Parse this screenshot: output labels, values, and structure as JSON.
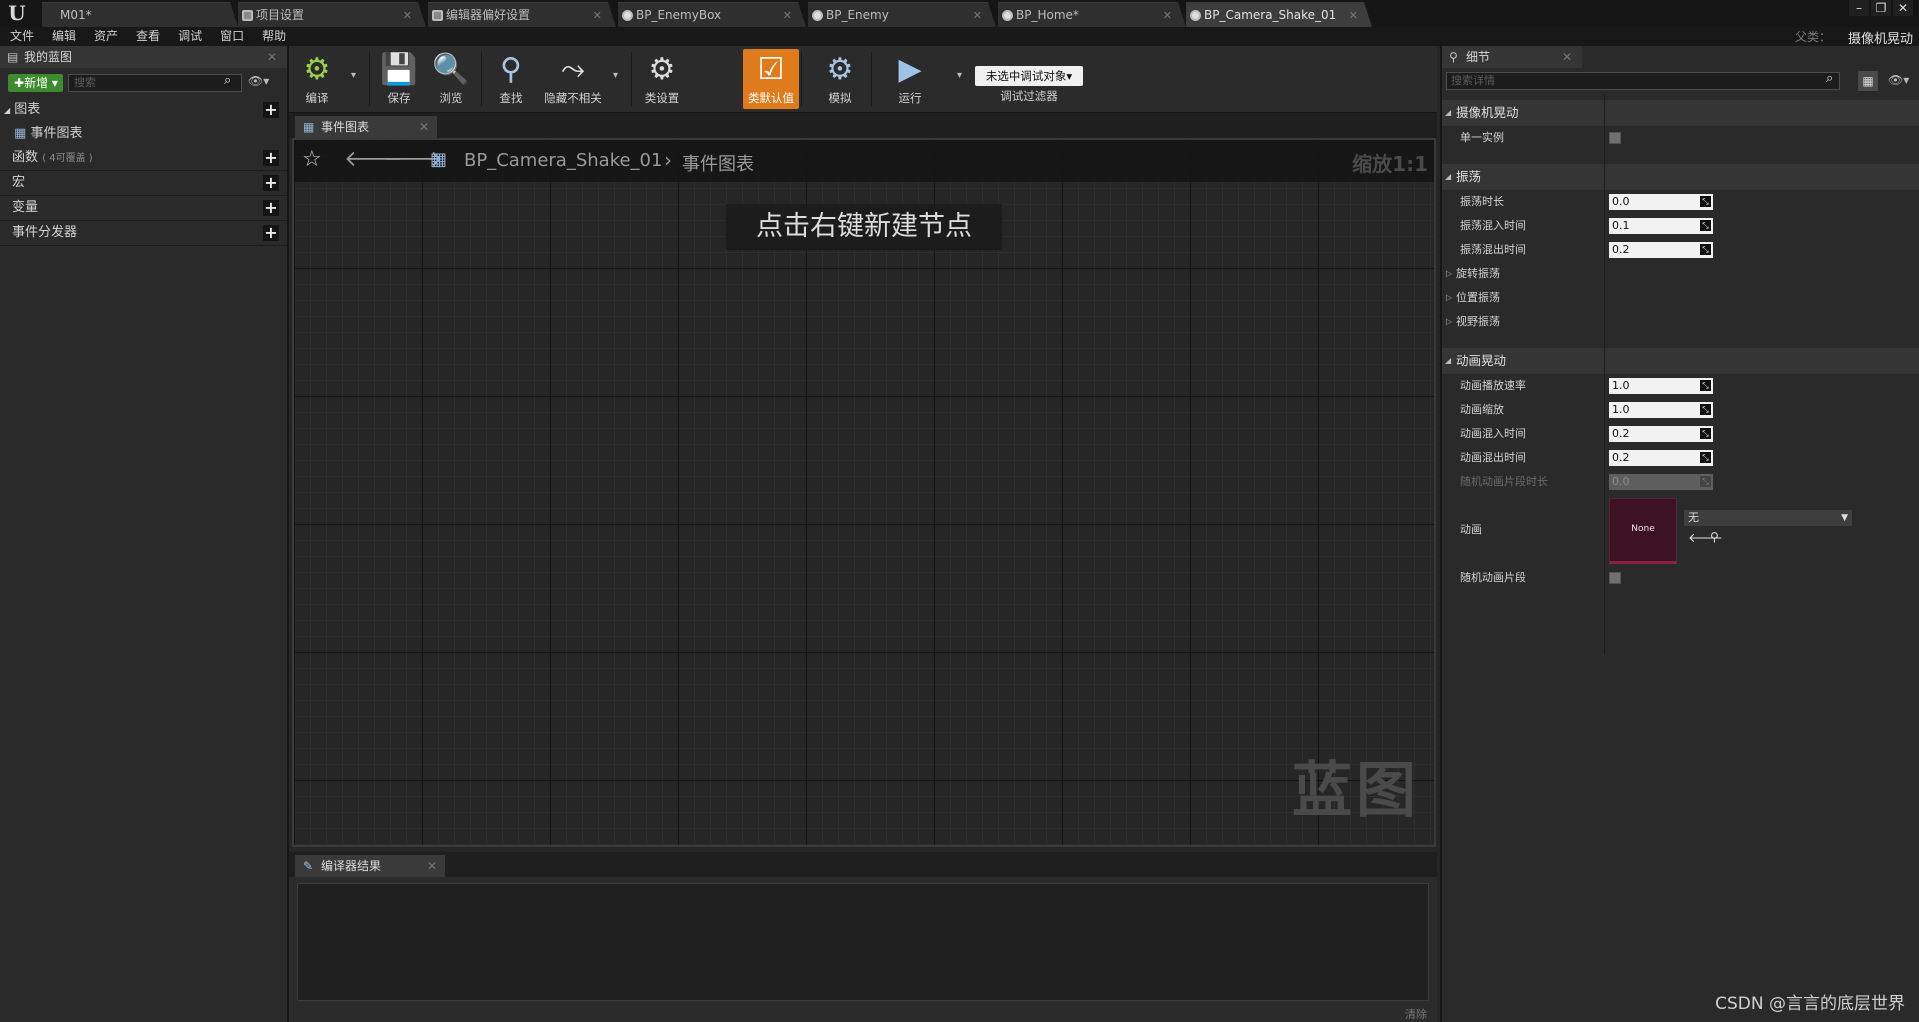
{
  "tabs": [
    {
      "label": "M01*",
      "active": false
    },
    {
      "label": "项目设置",
      "active": false
    },
    {
      "label": "编辑器偏好设置",
      "active": false
    },
    {
      "label": "BP_EnemyBox",
      "active": false
    },
    {
      "label": "BP_Enemy",
      "active": false
    },
    {
      "label": "BP_Home*",
      "active": false
    },
    {
      "label": "BP_Camera_Shake_01",
      "active": true
    }
  ],
  "parent_class": {
    "label": "父类：",
    "value": "摄像机晃动"
  },
  "menu": [
    "文件",
    "编辑",
    "资产",
    "查看",
    "调试",
    "窗口",
    "帮助"
  ],
  "my_blueprint": {
    "tab_label": "我的蓝图",
    "add_new_label": "新增",
    "search_placeholder": "搜索",
    "categories": {
      "graphs": "图表",
      "event_graph": "事件图表",
      "functions": "函数",
      "functions_sub": "( 4可覆盖 )",
      "macros": "宏",
      "variables": "变量",
      "dispatchers": "事件分发器"
    }
  },
  "toolbar": {
    "compile": "编译",
    "save": "保存",
    "browse": "浏览",
    "find": "查找",
    "hide_unrelated": "隐藏不相关",
    "class_settings": "类设置",
    "class_defaults": "类默认值",
    "simulate": "模拟",
    "play": "运行",
    "debug_object": "未选中调试对象",
    "debug_filter": "调试过滤器"
  },
  "graph": {
    "tab_label": "事件图表",
    "breadcrumb_root": "BP_Camera_Shake_01",
    "breadcrumb_leaf": "事件图表",
    "zoom": "缩放1:1",
    "hint": "点击右键新建节点",
    "watermark": "蓝图"
  },
  "compiler": {
    "tab_label": "编译器结果",
    "clear_label": "清除"
  },
  "details": {
    "tab_label": "细节",
    "search_placeholder": "搜索详情",
    "camera_shake": {
      "title": "摄像机晃动",
      "single_instance": "单一实例"
    },
    "oscillation": {
      "title": "振荡",
      "duration_label": "振荡时长",
      "duration": "0.0",
      "blend_in_label": "振荡混入时间",
      "blend_in": "0.1",
      "blend_out_label": "振荡混出时间",
      "blend_out": "0.2",
      "rot_label": "旋转振荡",
      "loc_label": "位置振荡",
      "fov_label": "视野振荡"
    },
    "anim_shake": {
      "title": "动画晃动",
      "play_rate_label": "动画播放速率",
      "play_rate": "1.0",
      "scale_label": "动画缩放",
      "scale": "1.0",
      "blend_in_label": "动画混入时间",
      "blend_in": "0.2",
      "blend_out_label": "动画混出时间",
      "blend_out": "0.2",
      "rand_dur_label": "随机动画片段时长",
      "rand_dur": "0.0",
      "anim_label": "动画",
      "anim_thumb": "None",
      "anim_value": "无",
      "rand_segment_label": "随机动画片段"
    }
  },
  "watermark": "CSDN @言言的底层世界",
  "colors": {
    "accent": "#e07b1c",
    "add_new": "#3c8b2e",
    "anim_asset": "#8c1f4a"
  }
}
